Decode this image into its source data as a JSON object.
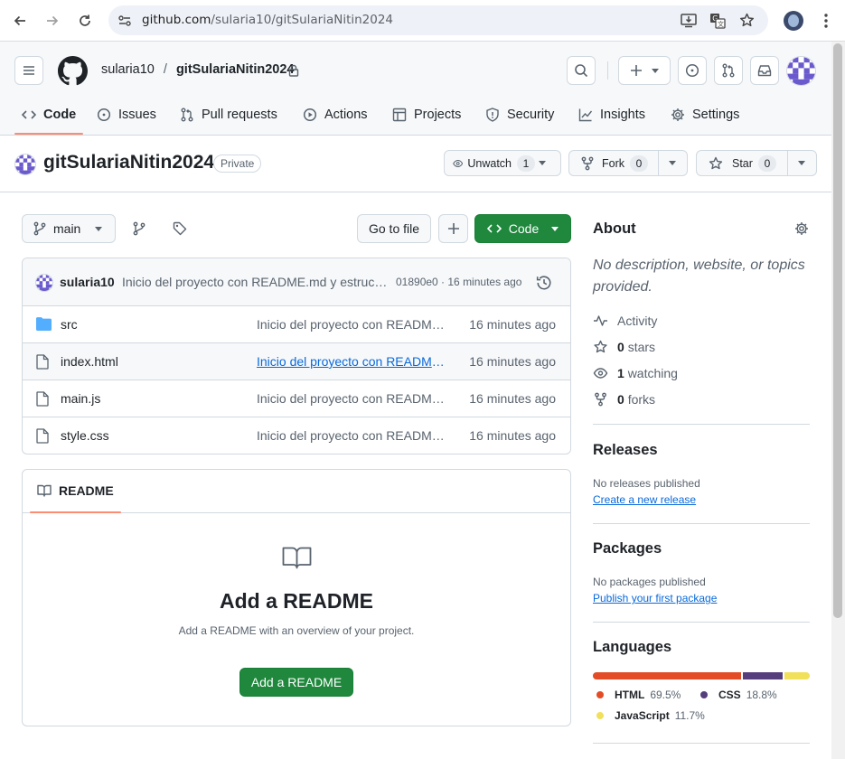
{
  "browser": {
    "url_domain": "github.com",
    "url_path": "/sularia10/gitSulariaNitin2024"
  },
  "header": {
    "owner": "sularia10",
    "separator": "/",
    "repo": "gitSulariaNitin2024"
  },
  "nav": {
    "tabs": [
      {
        "label": "Code"
      },
      {
        "label": "Issues"
      },
      {
        "label": "Pull requests"
      },
      {
        "label": "Actions"
      },
      {
        "label": "Projects"
      },
      {
        "label": "Security"
      },
      {
        "label": "Insights"
      },
      {
        "label": "Settings"
      }
    ]
  },
  "repo": {
    "name": "gitSulariaNitin2024",
    "visibility": "Private",
    "unwatch_label": "Unwatch",
    "watch_count": "1",
    "fork_label": "Fork",
    "fork_count": "0",
    "star_label": "Star",
    "star_count": "0"
  },
  "toolbar": {
    "branch": "main",
    "go_to_file": "Go to file",
    "plus": "+",
    "code_label": "Code"
  },
  "commit": {
    "author": "sularia10",
    "message": "Inicio del proyecto con README.md y estruc…",
    "meta": "01890e0 · 16 minutes ago"
  },
  "files": [
    {
      "name": "src",
      "type": "folder",
      "message": "Inicio del proyecto con README.md y estructura",
      "time": "16 minutes ago"
    },
    {
      "name": "index.html",
      "type": "file",
      "message": "Inicio del proyecto con README.md y estructura",
      "time": "16 minutes ago"
    },
    {
      "name": "main.js",
      "type": "file",
      "message": "Inicio del proyecto con README.md y estructura",
      "time": "16 minutes ago"
    },
    {
      "name": "style.css",
      "type": "file",
      "message": "Inicio del proyecto con README.md y estructura",
      "time": "16 minutes ago"
    }
  ],
  "readme": {
    "tab_label": "README",
    "title": "Add a README",
    "description": "Add a README with an overview of your project.",
    "button": "Add a README"
  },
  "about": {
    "heading": "About",
    "description": "No description, website, or topics provided.",
    "activity": "Activity",
    "stars_count": "0",
    "stars_label": "stars",
    "watching_count": "1",
    "watching_label": "watching",
    "forks_count": "0",
    "forks_label": "forks"
  },
  "releases": {
    "heading": "Releases",
    "empty": "No releases published",
    "link": "Create a new release"
  },
  "packages": {
    "heading": "Packages",
    "empty": "No packages published",
    "link": "Publish your first package"
  },
  "languages": {
    "heading": "Languages",
    "items": [
      {
        "name": "HTML",
        "percent": "69.5%",
        "value": 69.5,
        "color": "#e34c26"
      },
      {
        "name": "CSS",
        "percent": "18.8%",
        "value": 18.8,
        "color": "#563d7c"
      },
      {
        "name": "JavaScript",
        "percent": "11.7%",
        "value": 11.7,
        "color": "#f1e05a"
      }
    ]
  },
  "colors": {
    "accent_underline": "#fd8c73",
    "primary_button": "#1f883d",
    "link": "#0969da"
  }
}
